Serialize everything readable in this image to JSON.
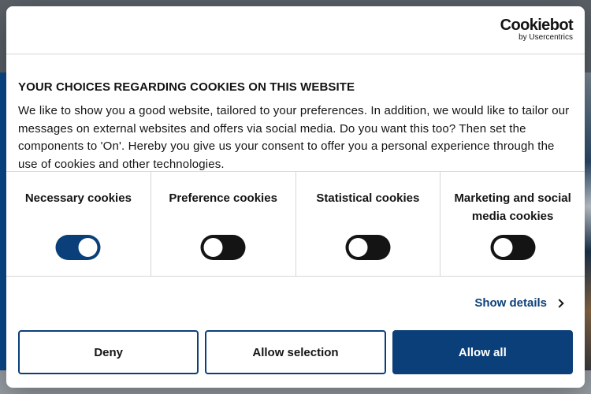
{
  "brand": {
    "name": "Cookiebot",
    "byline": "by Usercentrics"
  },
  "banner": {
    "title": "YOUR CHOICES REGARDING COOKIES ON THIS WEBSITE",
    "description": "We like to show you a good website, tailored to your preferences. In addition, we would like to tailor our messages on external websites and offers via social media. Do you want this too? Then set the components to 'On'. Hereby you give us your consent to offer you a personal experience through the use of cookies and other technologies."
  },
  "categories": [
    {
      "label": "Necessary cookies",
      "enabled": true
    },
    {
      "label": "Preference cookies",
      "enabled": false
    },
    {
      "label": "Statistical cookies",
      "enabled": false
    },
    {
      "label": "Marketing and social media cookies",
      "enabled": false
    }
  ],
  "details_link": "Show details",
  "buttons": {
    "deny": "Deny",
    "allow_selection": "Allow selection",
    "allow_all": "Allow all"
  },
  "colors": {
    "accent": "#0b3f7a",
    "text": "#141414",
    "divider": "#d6d6d6"
  }
}
